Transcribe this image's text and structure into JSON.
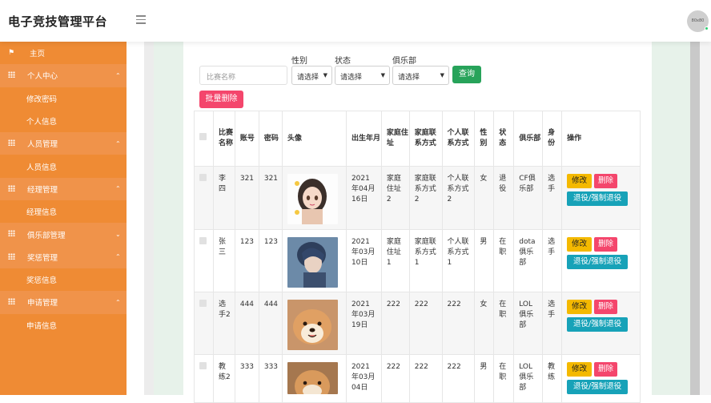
{
  "header": {
    "title": "电子竞技管理平台",
    "avatar_text": "80x80"
  },
  "sidebar": {
    "items": [
      {
        "label": "主页",
        "type": "home"
      },
      {
        "label": "个人中心",
        "type": "parent",
        "caret": "⌃"
      },
      {
        "label": "修改密码",
        "type": "sub"
      },
      {
        "label": "个人信息",
        "type": "sub"
      },
      {
        "label": "人员管理",
        "type": "parent",
        "caret": "⌃"
      },
      {
        "label": "人员信息",
        "type": "sub"
      },
      {
        "label": "经理管理",
        "type": "parent",
        "caret": "⌃"
      },
      {
        "label": "经理信息",
        "type": "sub"
      },
      {
        "label": "俱乐部管理",
        "type": "parent",
        "caret": "⌄"
      },
      {
        "label": "奖惩管理",
        "type": "parent",
        "caret": "⌃"
      },
      {
        "label": "奖惩信息",
        "type": "sub"
      },
      {
        "label": "申请管理",
        "type": "parent",
        "caret": "⌃"
      },
      {
        "label": "申请信息",
        "type": "sub"
      }
    ]
  },
  "filters": {
    "name_placeholder": "比赛名称",
    "gender_label": "性别",
    "gender_value": "请选择",
    "status_label": "状态",
    "status_value": "请选择",
    "club_label": "俱乐部",
    "club_value": "请选择",
    "query_button": "查询",
    "bulk_delete_button": "批量删除"
  },
  "table": {
    "headers": [
      "比赛名称",
      "账号",
      "密码",
      "头像",
      "出生年月",
      "家庭住址",
      "家庭联系方式",
      "个人联系方式",
      "性别",
      "状态",
      "俱乐部",
      "身份",
      "操作"
    ],
    "rows": [
      {
        "name": "李四",
        "account": "321",
        "password": "321",
        "birth": "2021年04月16日",
        "address": "家庭住址2",
        "family_contact": "家庭联系方式2",
        "personal_contact": "个人联系方式2",
        "gender": "女",
        "status": "退役",
        "club": "CF俱乐部",
        "identity": "选手",
        "avatar": "anime-girl"
      },
      {
        "name": "张三",
        "account": "123",
        "password": "123",
        "birth": "2021年03月10日",
        "address": "家庭住址1",
        "family_contact": "家庭联系方式1",
        "personal_contact": "个人联系方式1",
        "gender": "男",
        "status": "在职",
        "club": "dota俱乐部",
        "identity": "选手",
        "avatar": "anime-boy"
      },
      {
        "name": "选手2",
        "account": "444",
        "password": "444",
        "birth": "2021年03月19日",
        "address": "222",
        "family_contact": "222",
        "personal_contact": "222",
        "gender": "女",
        "status": "在职",
        "club": "LOL俱乐部",
        "identity": "选手",
        "avatar": "shiba-dog"
      },
      {
        "name": "教练2",
        "account": "333",
        "password": "333",
        "birth": "2021年03月04日",
        "address": "222",
        "family_contact": "222",
        "personal_contact": "222",
        "gender": "男",
        "status": "在职",
        "club": "LOL俱乐部",
        "identity": "教练",
        "avatar": "shiba-dog-2"
      }
    ],
    "actions": {
      "edit": "修改",
      "delete": "删除",
      "retire": "退役/强制退役"
    }
  },
  "colors": {
    "sidebar": "#ef8b34",
    "query": "#27a35a",
    "danger": "#f4466c",
    "warning": "#f4b900",
    "info": "#17a2b8"
  }
}
